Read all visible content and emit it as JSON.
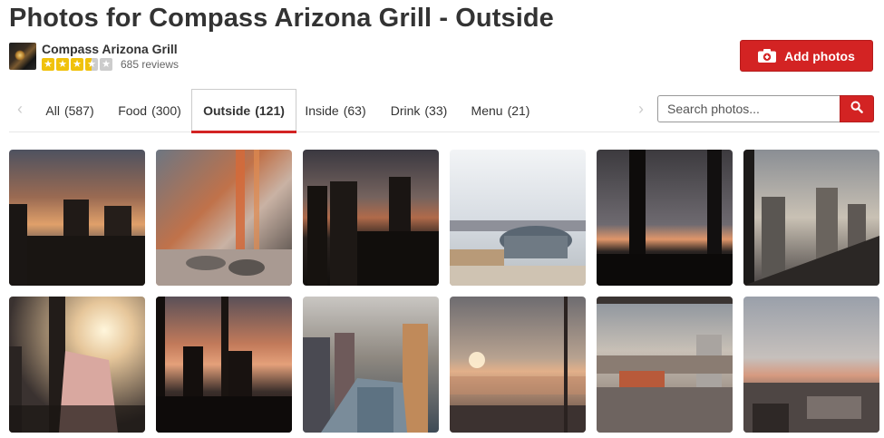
{
  "header": {
    "title": "Photos for Compass Arizona Grill - Outside"
  },
  "business": {
    "name": "Compass Arizona Grill",
    "rating": 3.5,
    "rating_max": 5,
    "review_count": "685 reviews",
    "star_glyph": "★"
  },
  "actions": {
    "add_photos_label": "Add photos",
    "accent_color": "#d32323"
  },
  "tabs": [
    {
      "label": "All",
      "count": "(587)",
      "active": false
    },
    {
      "label": "Food",
      "count": "(300)",
      "active": false
    },
    {
      "label": "Outside",
      "count": "(121)",
      "active": true
    },
    {
      "label": "Inside",
      "count": "(63)",
      "active": false
    },
    {
      "label": "Drink",
      "count": "(33)",
      "active": false
    },
    {
      "label": "Menu",
      "count": "(21)",
      "active": false
    }
  ],
  "nav": {
    "prev_glyph": "‹",
    "next_glyph": "›"
  },
  "search": {
    "placeholder": "Search photos...",
    "value": ""
  },
  "photos": [
    {
      "scene": "sunset skyline, orange clouds"
    },
    {
      "scene": "window reflection with dining table"
    },
    {
      "scene": "dark city towers at dusk"
    },
    {
      "scene": "stadium view, daytime"
    },
    {
      "scene": "window frame with pink horizon"
    },
    {
      "scene": "downtown towers, overcast"
    },
    {
      "scene": "sun glare behind window, menu card"
    },
    {
      "scene": "silhouette buildings through window, pink sky"
    },
    {
      "scene": "downtown highrises, blue glass"
    },
    {
      "scene": "hazy sunset over city"
    },
    {
      "scene": "city view with wall sign"
    },
    {
      "scene": "horizon at dusk over rooftops"
    }
  ]
}
